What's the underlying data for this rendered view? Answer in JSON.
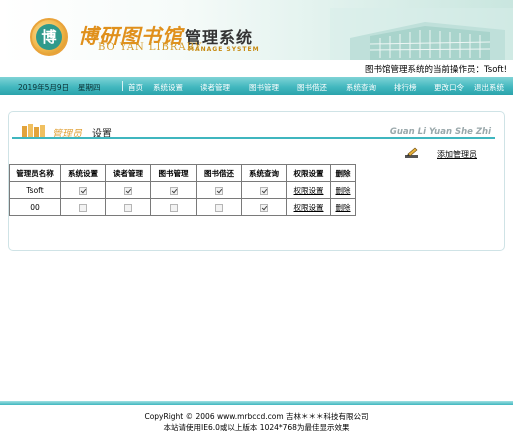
{
  "header": {
    "logo_char": "博",
    "title_cn": "博研图书馆",
    "title_suffix": "管理系统",
    "title_en": "BO YAN LIBRARY",
    "title_en_sub": "MANAGE SYSTEM"
  },
  "operator": {
    "text": "图书馆管理系统的当前操作员：Tsoft!"
  },
  "nav": {
    "date": "2019年5月9日",
    "weekday": "星期四",
    "items": [
      "首页",
      "系统设置",
      "读者管理",
      "图书管理",
      "图书借还",
      "系统查询",
      "排行榜",
      "更改口令",
      "退出系统"
    ]
  },
  "panel": {
    "title_part1": "管理员",
    "title_part2": "设置",
    "title_pinyin": "Guan Li Yuan She Zhi",
    "add_admin_label": "添加管理员"
  },
  "table": {
    "headers": [
      "管理员名称",
      "系统设置",
      "读者管理",
      "图书管理",
      "图书借还",
      "系统查询",
      "权限设置",
      "删除"
    ],
    "rows": [
      {
        "name": "Tsoft",
        "perms": [
          true,
          true,
          true,
          true,
          true
        ],
        "set_label": "权限设置",
        "delete_label": "删除"
      },
      {
        "name": "00",
        "perms": [
          false,
          false,
          false,
          false,
          true
        ],
        "set_label": "权限设置",
        "delete_label": "删除"
      }
    ]
  },
  "footer": {
    "line1": "CopyRight © 2006 www.mrbccd.com 吉林＊＊＊科技有限公司",
    "line2": "本站请使用IE6.0或以上版本 1024*768为最佳显示效果"
  },
  "colors": {
    "nav_bg": "#43b8bf",
    "accent_orange": "#e2a33b",
    "title_line": "#3fb6bf"
  }
}
